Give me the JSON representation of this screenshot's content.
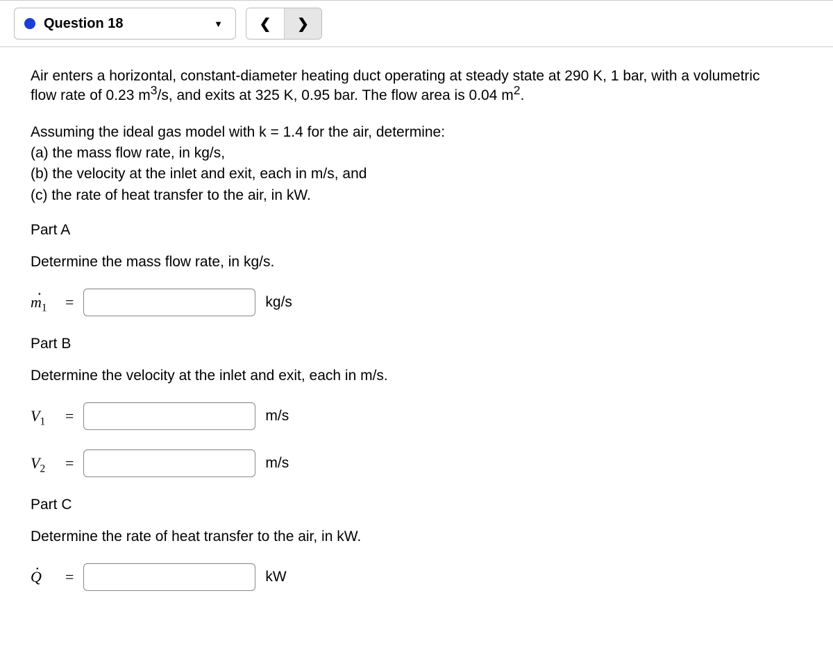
{
  "header": {
    "question_label": "Question 18"
  },
  "problem": {
    "intro_html": "Air enters a horizontal, constant-diameter heating duct operating at steady state at 290 K, 1 bar, with a volumetric flow rate of 0.23 m<sup>3</sup>/s, and exits at 325 K, 0.95 bar. The flow area is 0.04 m<sup>2</sup>.",
    "assume": "Assuming the ideal gas model with k = 1.4 for the air, determine:",
    "a": "(a) the mass flow rate, in kg/s,",
    "b": "(b) the velocity at the inlet and exit, each in m/s, and",
    "c": "(c) the rate of heat transfer to the air, in kW."
  },
  "parts": {
    "A": {
      "title": "Part A",
      "prompt": "Determine the mass flow rate, in kg/s.",
      "unit": "kg/s"
    },
    "B": {
      "title": "Part B",
      "prompt": "Determine the velocity at the inlet and exit, each in m/s.",
      "unit1": "m/s",
      "unit2": "m/s"
    },
    "C": {
      "title": "Part C",
      "prompt": "Determine the rate of heat transfer to the air, in kW.",
      "unit": "kW"
    }
  }
}
